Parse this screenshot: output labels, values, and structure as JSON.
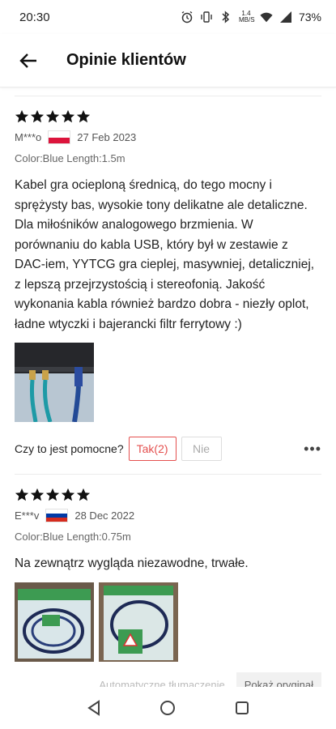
{
  "status": {
    "time": "20:30",
    "net_speed_value": "1.4",
    "net_speed_unit": "MB/S",
    "battery": "73%"
  },
  "header": {
    "title": "Opinie klientów"
  },
  "reviews": [
    {
      "stars": 5,
      "author": "M***o",
      "country_flag": "flag-poland",
      "flag_colors": [
        "#ffffff",
        "#dc143c"
      ],
      "date": "27 Feb 2023",
      "variant": "Color:Blue Length:1.5m",
      "text": "Kabel gra ocieploną średnicą, do tego mocny i sprężysty bas, wysokie tony delikatne ale detaliczne. Dla miłośników analogowego brzmienia. W porównaniu do kabla USB, który był w zestawie z DAC-iem, YYTCG gra cieplej, masywniej, detaliczniej, z lepszą przejrzystością i stereofonią. Jakość wykonania kabla również bardzo dobra - niezły oplot, ładne wtyczki i bajerancki filtr ferrytowy :)",
      "photos": [
        "photo-cables-dac"
      ],
      "helpful_label": "Czy to jest pomocne?",
      "yes_label": "Tak(2)",
      "no_label": "Nie",
      "more_label": "•••"
    },
    {
      "stars": 5,
      "author": "E***v",
      "country_flag": "flag-russia",
      "flag_colors": [
        "#ffffff",
        "#0039a6",
        "#d52b1e"
      ],
      "date": "28 Dec 2022",
      "variant": "Color:Blue Length:0.75m",
      "text": "Na zewnątrz wygląda niezawodne, trwałe.",
      "photos": [
        "photo-packaged-cable-1",
        "photo-packaged-cable-2"
      ]
    }
  ],
  "translate": {
    "auto_label": "Automatyczne tłumaczenie",
    "show_original_label": "Pokaż oryginał"
  },
  "colors": {
    "star": "#111111",
    "accent": "#e4504f"
  }
}
